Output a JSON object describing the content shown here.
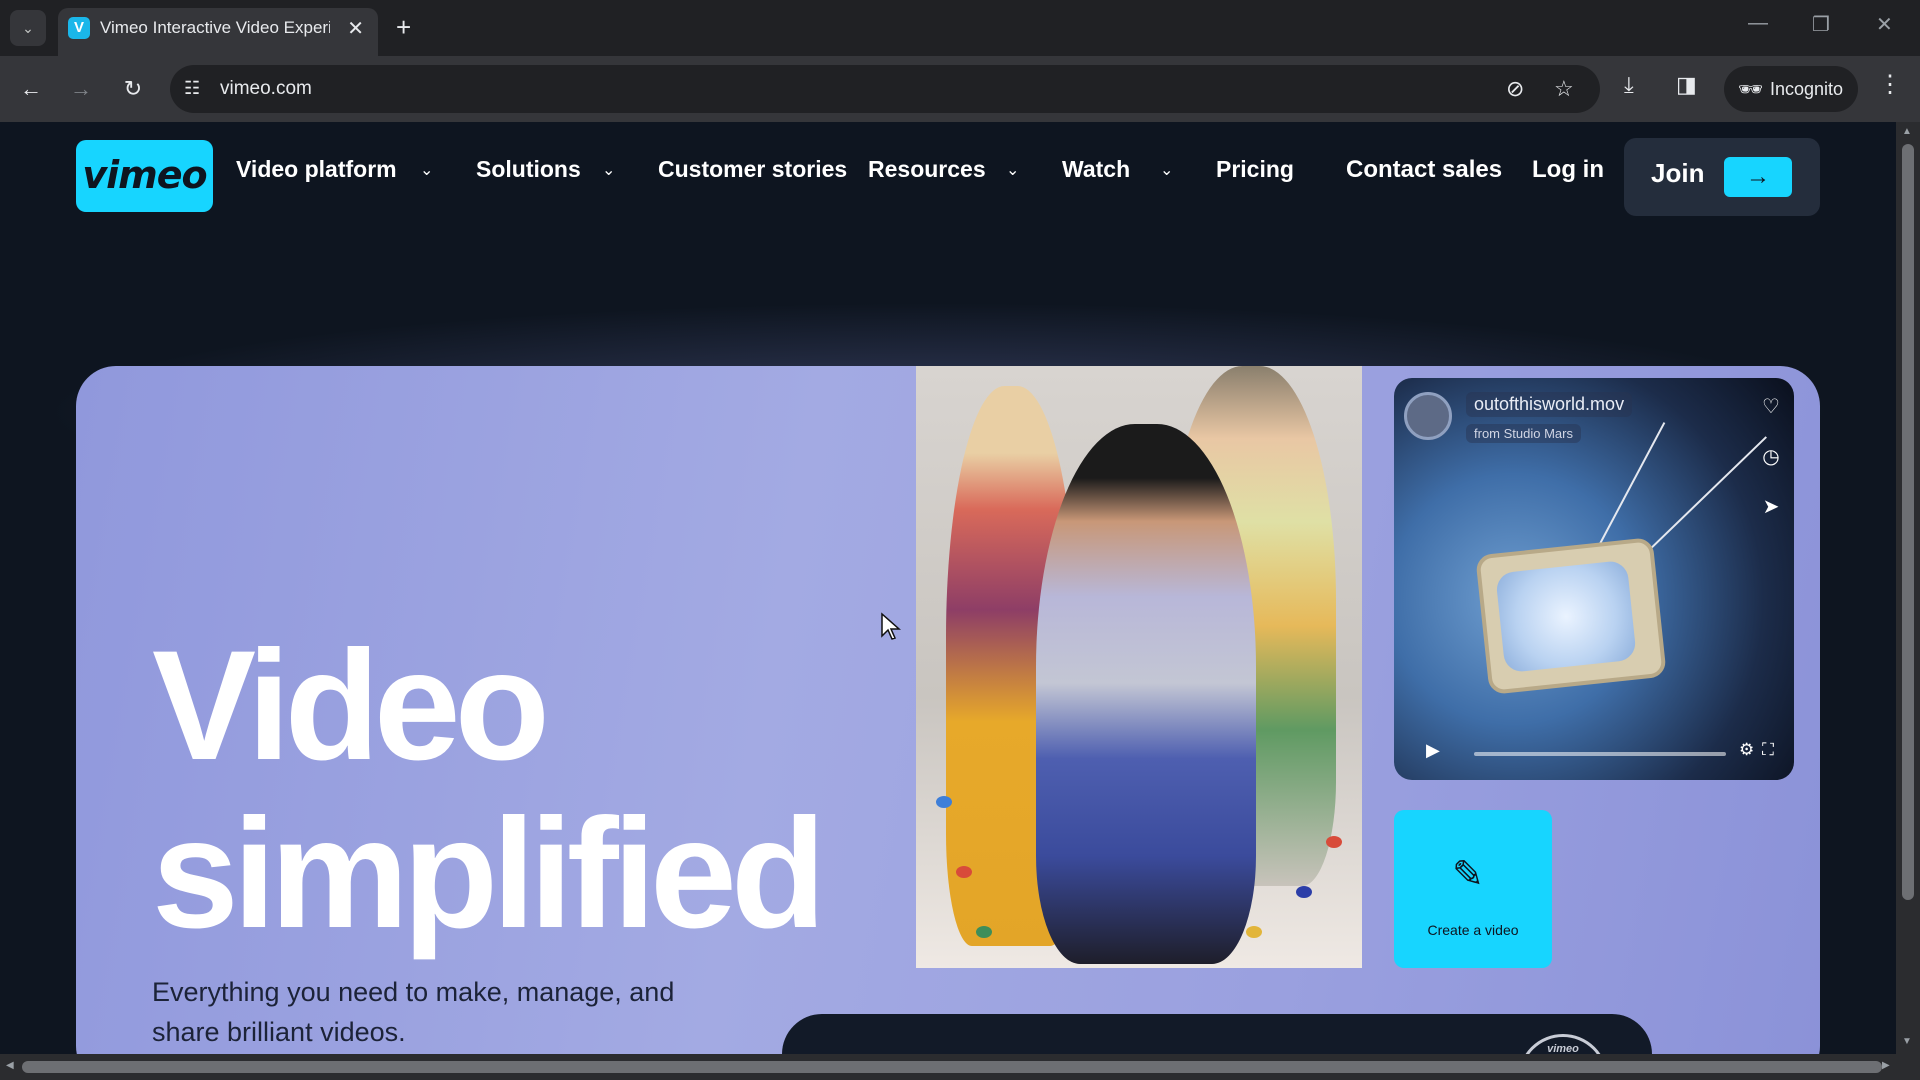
{
  "browser": {
    "tab_title": "Vimeo Interactive Video Experi",
    "favicon_letter": "V",
    "url": "vimeo.com",
    "incognito_label": "Incognito"
  },
  "nav": {
    "logo": "vimeo",
    "items": [
      {
        "label": "Video platform",
        "has_dropdown": true
      },
      {
        "label": "Solutions",
        "has_dropdown": true
      },
      {
        "label": "Customer stories",
        "has_dropdown": false
      },
      {
        "label": "Resources",
        "has_dropdown": true
      },
      {
        "label": "Watch",
        "has_dropdown": true
      },
      {
        "label": "Pricing",
        "has_dropdown": false
      }
    ],
    "contact_sales": "Contact sales",
    "log_in": "Log in",
    "join": "Join"
  },
  "hero": {
    "title_line1": "Video",
    "title_line2": "simplified",
    "subtitle_line1": "Everything you need to make, manage, and",
    "subtitle_line2": "share brilliant videos.",
    "video_card": {
      "title": "outofthisworld.mov",
      "from": "from Studio Mars"
    },
    "create_card_label": "Create a video",
    "badge_label": "vimeo"
  },
  "colors": {
    "accent": "#17d5ff",
    "page_bg": "#0e1520",
    "hero_bg": "#9ca3e0"
  },
  "icons": [
    "tab-list-icon",
    "close-icon",
    "plus-icon",
    "back-icon",
    "forward-icon",
    "reload-icon",
    "site-info-icon",
    "eye-off-icon",
    "star-icon",
    "download-icon",
    "side-panel-icon",
    "incognito-icon",
    "more-vert-icon",
    "chevron-down-icon",
    "arrow-right-icon",
    "heart-icon",
    "clock-icon",
    "send-icon",
    "play-icon",
    "gear-icon",
    "fullscreen-icon",
    "magic-wand-icon"
  ]
}
